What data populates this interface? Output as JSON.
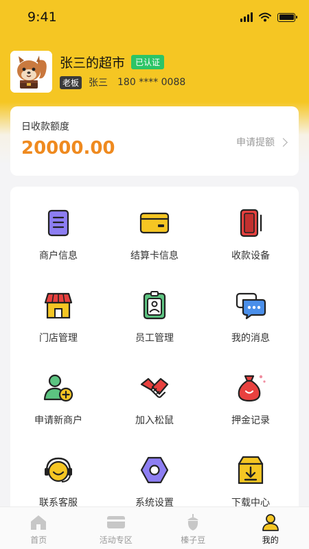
{
  "status_bar": {
    "time": "9:41"
  },
  "profile": {
    "store_name": "张三的超市",
    "verified_badge": "已认证",
    "role_badge": "老板",
    "owner_name": "张三",
    "phone": "180 **** 0088",
    "avatar_icon": "squirrel-mascot"
  },
  "quota": {
    "label": "日收款额度",
    "amount": "20000.00",
    "link_label": "申请提额"
  },
  "menu": [
    {
      "label": "商户信息",
      "icon": "document-icon"
    },
    {
      "label": "结算卡信息",
      "icon": "card-icon"
    },
    {
      "label": "收款设备",
      "icon": "pos-device-icon"
    },
    {
      "label": "门店管理",
      "icon": "store-icon"
    },
    {
      "label": "员工管理",
      "icon": "badge-icon"
    },
    {
      "label": "我的消息",
      "icon": "chat-icon"
    },
    {
      "label": "申请新商户",
      "icon": "add-user-icon"
    },
    {
      "label": "加入松鼠",
      "icon": "handshake-icon"
    },
    {
      "label": "押金记录",
      "icon": "money-bag-icon"
    },
    {
      "label": "联系客服",
      "icon": "headset-icon"
    },
    {
      "label": "系统设置",
      "icon": "settings-icon"
    },
    {
      "label": "下载中心",
      "icon": "download-icon"
    }
  ],
  "tabs": [
    {
      "label": "首页",
      "icon": "home-icon",
      "active": false
    },
    {
      "label": "活动专区",
      "icon": "card-icon",
      "active": false
    },
    {
      "label": "榛子豆",
      "icon": "nut-icon",
      "active": false
    },
    {
      "label": "我的",
      "icon": "user-icon",
      "active": true
    }
  ],
  "colors": {
    "brand_yellow": "#f5c623",
    "amount_orange": "#ef8a1f",
    "verified_green": "#2cc467"
  }
}
